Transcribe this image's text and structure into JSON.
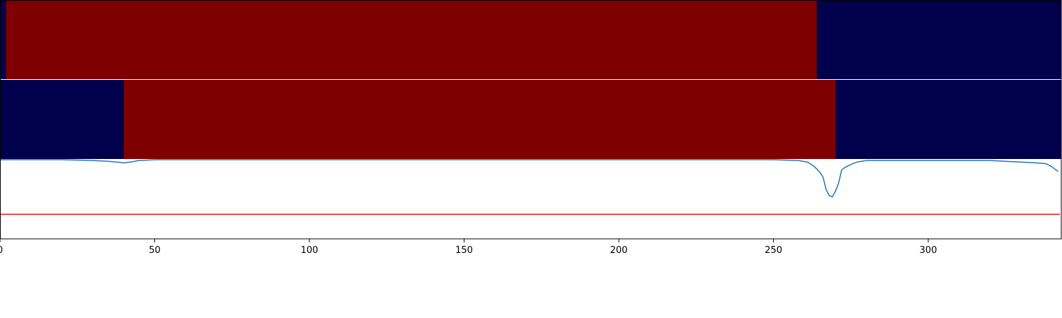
{
  "chart_data": {
    "type": "heatmap",
    "title": "",
    "xlabel": "",
    "ylabel": "",
    "xlim": [
      0,
      343
    ],
    "xticks": [
      0,
      50,
      100,
      150,
      200,
      250,
      300
    ],
    "grid": false,
    "colors": {
      "low": "#00004c",
      "high": "#7f0000",
      "line": "#1f77b4",
      "threshold": "#e41a1c",
      "axis": "#000000",
      "separator": "#ffffff"
    },
    "tracks": [
      {
        "type": "segments",
        "segments": [
          {
            "start": 0,
            "end": 2,
            "level": "low"
          },
          {
            "start": 2,
            "end": 264,
            "level": "high"
          },
          {
            "start": 264,
            "end": 343,
            "level": "low"
          }
        ]
      },
      {
        "type": "segments",
        "segments": [
          {
            "start": 0,
            "end": 40,
            "level": "low"
          },
          {
            "start": 40,
            "end": 270,
            "level": "high"
          },
          {
            "start": 270,
            "end": 343,
            "level": "low"
          }
        ]
      }
    ],
    "line_panel": {
      "ylim": [
        -1.0,
        0.0
      ],
      "threshold": -0.69,
      "x": [
        0,
        10,
        20,
        30,
        35,
        38,
        40,
        42,
        45,
        50,
        100,
        150,
        200,
        250,
        258,
        261,
        263,
        264,
        265,
        266,
        267,
        268,
        269,
        270,
        271,
        272,
        273,
        275,
        277,
        280,
        290,
        300,
        310,
        320,
        325,
        330,
        335,
        338,
        340,
        342
      ],
      "y": [
        0.0,
        0.0,
        0.0,
        -0.01,
        -0.02,
        -0.03,
        -0.04,
        -0.03,
        -0.01,
        0.0,
        0.0,
        0.0,
        0.0,
        0.0,
        -0.01,
        -0.03,
        -0.08,
        -0.12,
        -0.16,
        -0.22,
        -0.38,
        -0.45,
        -0.47,
        -0.4,
        -0.3,
        -0.13,
        -0.1,
        -0.06,
        -0.03,
        -0.01,
        -0.01,
        -0.01,
        -0.01,
        -0.01,
        -0.02,
        -0.03,
        -0.04,
        -0.05,
        -0.09,
        -0.15
      ]
    }
  }
}
